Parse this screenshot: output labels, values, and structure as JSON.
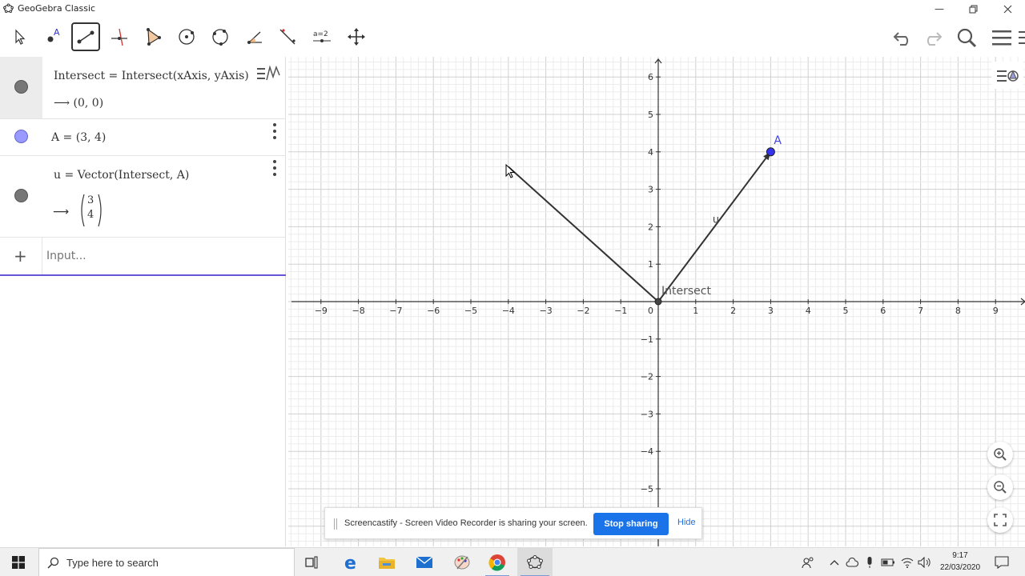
{
  "window": {
    "title": "GeoGebra Classic"
  },
  "toolbar": {
    "tools": [
      {
        "name": "move-tool",
        "icon": "arrow-pointer-icon"
      },
      {
        "name": "point-tool",
        "icon": "point-icon"
      },
      {
        "name": "segment-tool",
        "icon": "segment-icon",
        "selected": true
      },
      {
        "name": "perpendicular-line-tool",
        "icon": "perpendicular-icon"
      },
      {
        "name": "polygon-tool",
        "icon": "polygon-icon"
      },
      {
        "name": "circle-tool",
        "icon": "circle-center-icon"
      },
      {
        "name": "circle-three-points-tool",
        "icon": "circle-three-points-icon"
      },
      {
        "name": "angle-tool",
        "icon": "angle-icon"
      },
      {
        "name": "reflect-tool",
        "icon": "reflect-line-icon"
      },
      {
        "name": "slider-tool",
        "icon": "slider-icon",
        "label": "a=2"
      },
      {
        "name": "move-graphics-tool",
        "icon": "move-arrows-icon"
      }
    ]
  },
  "algebra": {
    "rows": [
      {
        "definition": "Intersect = Intersect(xAxis, yAxis)",
        "value": "⟶  (0, 0)",
        "color": "#777777"
      },
      {
        "definition": "A = (3, 4)",
        "color": "#9999ff"
      },
      {
        "definition": "u = Vector(Intersect, A)",
        "value_top": "3",
        "value_bottom": "4",
        "color": "#777777"
      }
    ],
    "input_placeholder": "Input...",
    "add_symbol": "+"
  },
  "graphics": {
    "point_label_A": "A",
    "vector_label": "u",
    "intersect_label": "Intersect",
    "axis_x_ticks": [
      "−9",
      "−8",
      "−7",
      "−6",
      "−5",
      "−4",
      "−3",
      "−2",
      "−1",
      "1",
      "2",
      "3",
      "4",
      "5",
      "6",
      "7",
      "8",
      "9"
    ],
    "axis_y_ticks": [
      "6",
      "5",
      "4",
      "3",
      "2",
      "1",
      "−1",
      "−2",
      "−3",
      "−4",
      "−5"
    ],
    "origin_label": "0"
  },
  "chart_data": {
    "type": "scatter",
    "points": [
      {
        "label": "Intersect",
        "x": 0,
        "y": 0,
        "color": "#444444"
      },
      {
        "label": "A",
        "x": 3,
        "y": 4,
        "color": "#3333ee"
      }
    ],
    "vectors": [
      {
        "label": "u",
        "from": [
          0,
          0
        ],
        "to": [
          3,
          4
        ]
      }
    ],
    "segments": [
      {
        "from": [
          0,
          0
        ],
        "to": [
          -4,
          3.6
        ]
      }
    ],
    "xlim": [
      -9.5,
      9.5
    ],
    "ylim": [
      -5.8,
      6.3
    ],
    "grid": true
  },
  "banner": {
    "message": "Screencastify - Screen Video Recorder is sharing your screen.",
    "stop_label": "Stop sharing",
    "hide_label": "Hide"
  },
  "taskbar": {
    "search_placeholder": "Type here to search",
    "time": "9:17",
    "date": "22/03/2020"
  }
}
